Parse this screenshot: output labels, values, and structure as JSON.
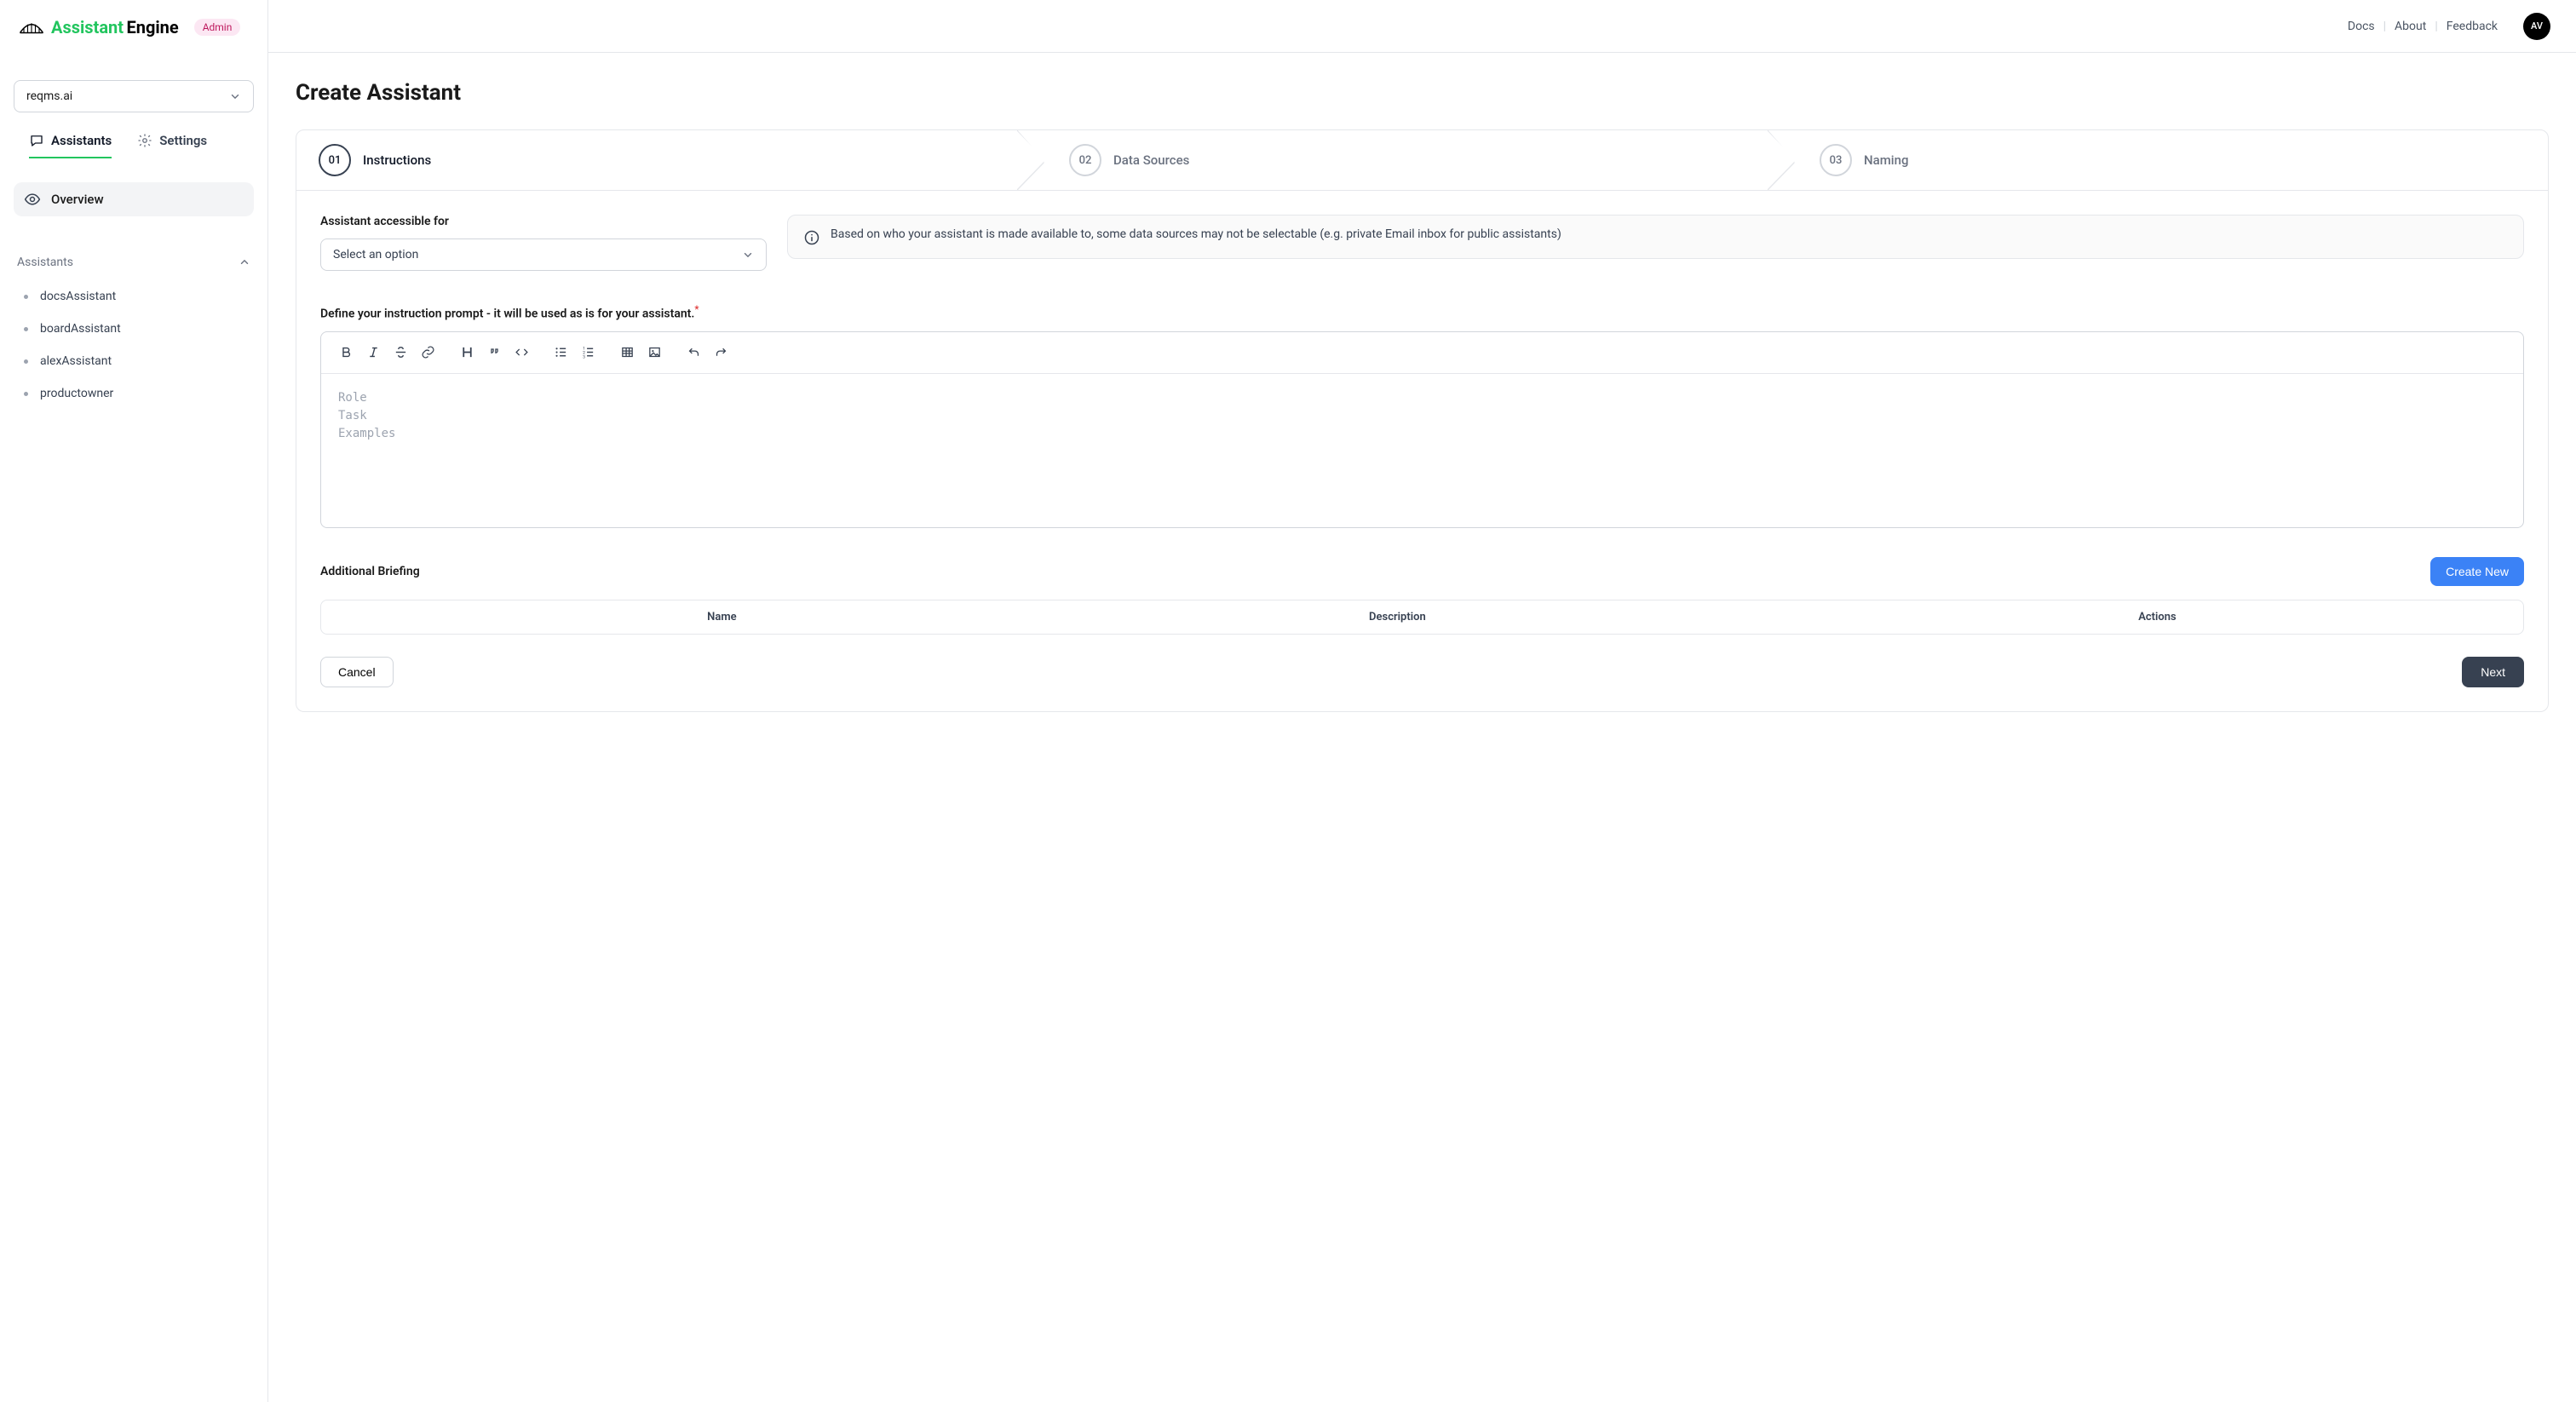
{
  "header": {
    "logo_part1": "Assistant",
    "logo_part2": "Engine",
    "admin_badge": "Admin",
    "links": {
      "docs": "Docs",
      "about": "About",
      "feedback": "Feedback"
    },
    "avatar_initials": "AV"
  },
  "sidebar": {
    "org_selector": "reqms.ai",
    "tabs": {
      "assistants": "Assistants",
      "settings": "Settings"
    },
    "overview": "Overview",
    "assistants_section_label": "Assistants",
    "assistants": [
      {
        "label": "docsAssistant"
      },
      {
        "label": "boardAssistant"
      },
      {
        "label": "alexAssistant"
      },
      {
        "label": "productowner"
      }
    ]
  },
  "main": {
    "title": "Create Assistant",
    "steps": [
      {
        "num": "01",
        "label": "Instructions"
      },
      {
        "num": "02",
        "label": "Data Sources"
      },
      {
        "num": "03",
        "label": "Naming"
      }
    ],
    "accessible_label": "Assistant accessible for",
    "accessible_placeholder": "Select an option",
    "info_text": "Based on who your assistant is made available to, some data sources may not be selectable (e.g. private Email inbox for public assistants)",
    "prompt_label": "Define your instruction prompt - it will be used as is for your assistant.",
    "editor_placeholder": "Role\nTask\nExamples",
    "briefing_label": "Additional Briefing",
    "create_new_button": "Create New",
    "table": {
      "headers": {
        "name": "Name",
        "description": "Description",
        "actions": "Actions"
      }
    },
    "buttons": {
      "cancel": "Cancel",
      "next": "Next"
    }
  }
}
